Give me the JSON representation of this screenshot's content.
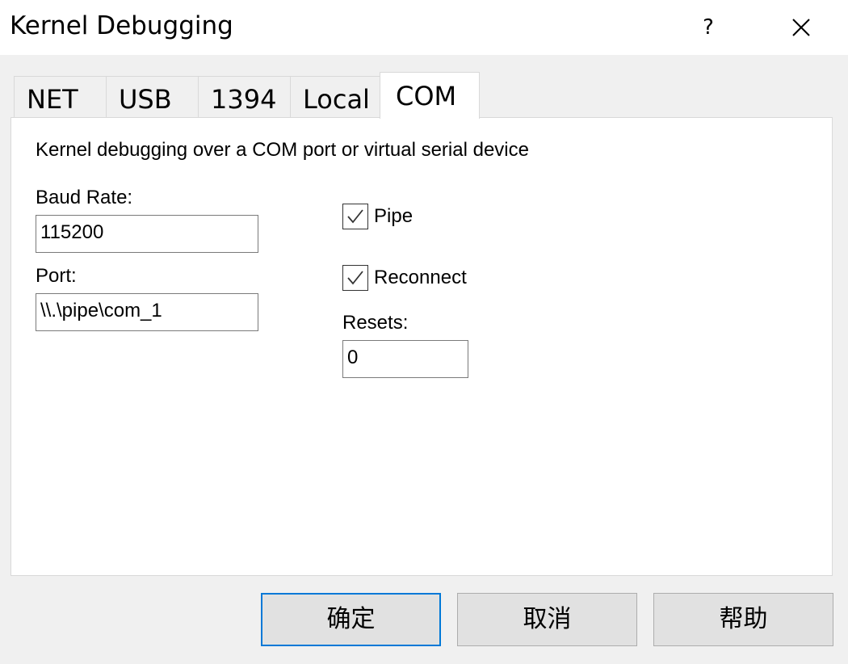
{
  "window": {
    "title": "Kernel Debugging",
    "help_glyph": "?"
  },
  "tabs": [
    {
      "label": "NET"
    },
    {
      "label": "USB"
    },
    {
      "label": "1394"
    },
    {
      "label": "Local"
    },
    {
      "label": "COM",
      "active": true
    }
  ],
  "com": {
    "description": "Kernel debugging over a COM port or virtual serial device",
    "baud_rate_label": "Baud Rate:",
    "baud_rate_value": "115200",
    "port_label": "Port:",
    "port_value": "\\\\.\\pipe\\com_1",
    "pipe_label": "Pipe",
    "pipe_checked": true,
    "reconnect_label": "Reconnect",
    "reconnect_checked": true,
    "resets_label": "Resets:",
    "resets_value": "0"
  },
  "buttons": {
    "ok": "确定",
    "cancel": "取消",
    "help": "帮助"
  },
  "colors": {
    "default_button_border": "#0078d7",
    "panel_bg": "#ffffff",
    "dialog_bg": "#f0f0f0"
  }
}
